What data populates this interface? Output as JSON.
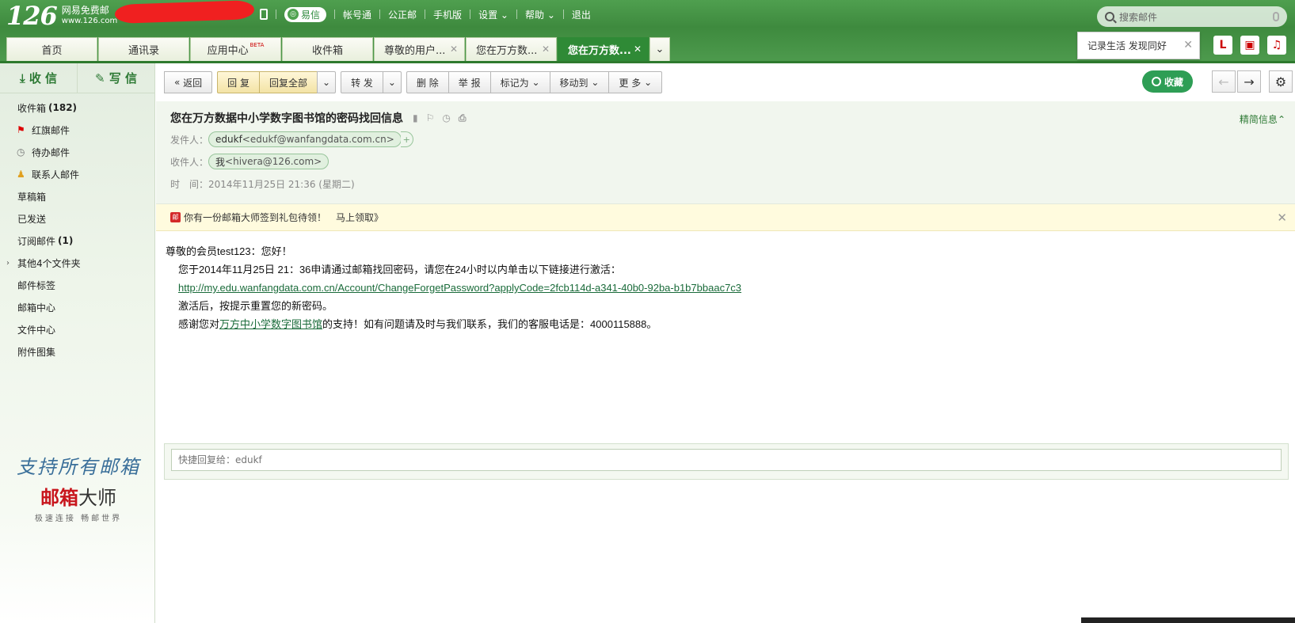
{
  "brand": {
    "logo_num": "126",
    "logo_title": "网易免费邮",
    "logo_url": "www.126.com"
  },
  "topnav": {
    "yixin": "易信",
    "items": [
      "帐号通",
      "公正邮",
      "手机版",
      "设置",
      "帮助",
      "退出"
    ]
  },
  "search": {
    "placeholder": "搜索邮件"
  },
  "tabs": [
    {
      "label": "首页"
    },
    {
      "label": "通讯录"
    },
    {
      "label": "应用中心",
      "badge": "BETA"
    },
    {
      "label": "收件箱"
    },
    {
      "label": "尊敬的用户..."
    },
    {
      "label": "您在万方数..."
    },
    {
      "label": "您在万方数..."
    }
  ],
  "tip": {
    "text": "记录生活 发现同好"
  },
  "top_icons": [
    "L",
    "book-icon",
    "music-icon"
  ],
  "sidebar": {
    "receive": "收 信",
    "compose": "写 信",
    "folders": [
      {
        "label": "收件箱",
        "count": "(182)"
      },
      {
        "label": "红旗邮件",
        "icon": "red-flag-icon"
      },
      {
        "label": "待办邮件",
        "icon": "clock-icon"
      },
      {
        "label": "联系人邮件",
        "icon": "person-icon"
      },
      {
        "label": "草稿箱"
      },
      {
        "label": "已发送"
      },
      {
        "label": "订阅邮件",
        "count": "(1)"
      },
      {
        "label": "其他4个文件夹",
        "expand": true
      },
      {
        "label": "邮件标签"
      },
      {
        "label": "邮箱中心"
      },
      {
        "label": "文件中心"
      },
      {
        "label": "附件图集"
      }
    ],
    "ad": {
      "line1": "支持所有邮箱",
      "line2_red": "邮箱",
      "line2_black": "大师",
      "line2_pre": "",
      "line3": "极速连接 畅邮世界"
    }
  },
  "toolbar": {
    "back": "返回",
    "reply": "回 复",
    "reply_all": "回复全部",
    "forward": "转 发",
    "delete": "删 除",
    "report": "举 报",
    "mark_as": "标记为",
    "move_to": "移动到",
    "more": "更 多",
    "collect": "收藏"
  },
  "mail": {
    "subject": "您在万方数据中小学数字图书馆的密码找回信息",
    "brief_label": "精简信息",
    "from_label": "发件人：",
    "from_name": "edukf",
    "from_addr": "<edukf@wanfangdata.com.cn>",
    "to_label": "收件人：",
    "to_name": "我",
    "to_addr": "<hivera@126.com>",
    "time_label": "时　间：",
    "time": "2014年11月25日 21:36 (星期二)"
  },
  "notice": {
    "text": "你有一份邮箱大师签到礼包待领！",
    "link": "马上领取》"
  },
  "body": {
    "greeting": "尊敬的会员test123：您好！",
    "line1": "您于2014年11月25日 21：36申请通过邮箱找回密码，请您在24小时以内单击以下链接进行激活：",
    "link": "http://my.edu.wanfangdata.com.cn/Account/ChangeForgetPassword?applyCode=2fcb114d-a341-40b0-92ba-b1b7bbaac7c3",
    "line3": "激活后，按提示重置您的新密码。",
    "thanks_pre": "感谢您对",
    "thanks_link": "万方中小学数字图书馆",
    "thanks_post": "的支持！如有问题请及时与我们联系，我们的客服电话是：4000115888。"
  },
  "quick_reply": {
    "placeholder": "快捷回复给：edukf"
  }
}
